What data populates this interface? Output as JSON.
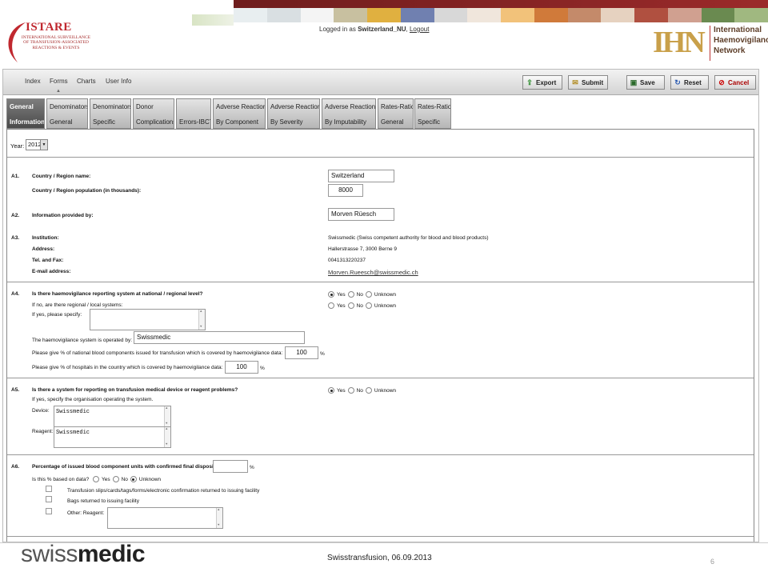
{
  "header": {
    "istare_title": "ISTARE",
    "istare_subtitle": "International Surveillance of Transfusion-Associated Reactions & Events",
    "login_prefix": "Logged in as",
    "login_user": "Switzerland_NU",
    "logout_label": "Logout",
    "ihn_letters": "IHN",
    "ihn_name_line1": "International",
    "ihn_name_line2": "Haemovigilance",
    "ihn_name_line3": "Network"
  },
  "menu": {
    "items": [
      "Index",
      "Forms",
      "Charts",
      "User Info"
    ]
  },
  "toolbar": {
    "export": "Export",
    "submit": "Submit",
    "save": "Save",
    "reset": "Reset",
    "cancel": "Cancel"
  },
  "tabs": [
    {
      "line1": "General",
      "line2": "Information",
      "active": true
    },
    {
      "line1": "Denominators",
      "line2": "General"
    },
    {
      "line1": "Denominators",
      "line2": "Specific"
    },
    {
      "line1": "Donor",
      "line2": "Complications"
    },
    {
      "line1": "",
      "line2": "Errors-IBCT"
    },
    {
      "line1": "Adverse Reactions",
      "line2": "By Component"
    },
    {
      "line1": "Adverse Reactions",
      "line2": "By Severity"
    },
    {
      "line1": "Adverse Reactions",
      "line2": "By Imputability"
    },
    {
      "line1": "Rates-Ratio",
      "line2": "General"
    },
    {
      "line1": "Rates-Ratio",
      "line2": "Specific"
    }
  ],
  "form": {
    "year_label": "Year:",
    "year_value": "2012",
    "a1": {
      "id": "A1.",
      "country_label": "Country / Region name:",
      "country_value": "Switzerland",
      "population_label": "Country / Region population (in thousands):",
      "population_value": "8000"
    },
    "a2": {
      "id": "A2.",
      "label": "Information provided by:",
      "value": "Morven Rüesch"
    },
    "a3": {
      "id": "A3.",
      "institution_label": "Institution:",
      "institution_value": "Swissmedic (Swiss competent authority for blood and blood products)",
      "address_label": "Address:",
      "address_value": "Hallerstrasse 7, 3000 Berne 9",
      "tel_label": "Tel. and Fax:",
      "tel_value": "0041313220237",
      "email_label": "E-mail address:",
      "email_value": "Morven.Rueesch@swissmedic.ch"
    },
    "a4": {
      "id": "A4.",
      "question": "Is there haemovigilance reporting system at national / regional level?",
      "regional_label": "If no, are there regional / local systems:",
      "specify_label": "If yes, please specify:",
      "operated_label": "The haemovigilance system is operated by:",
      "operated_value": "Swissmedic",
      "pct_blood_label": "Please give % of national blood components issued for transfusion which is covered by haemovigilance data:",
      "pct_blood_value": "100",
      "pct_hosp_label": "Please give % of hospitals in the country which is covered by haemovigilance data:",
      "pct_hosp_value": "100",
      "pct_sign": "%"
    },
    "a5": {
      "id": "A5.",
      "question": "Is there a system for reporting on transfusion medical device or reagent problems?",
      "specify_label": "If yes, specify the organisation operating the system.",
      "device_label": "Device:",
      "device_value": "Swissmedic",
      "reagent_label": "Reagent:",
      "reagent_value": "Swissmedic"
    },
    "a6": {
      "id": "A6.",
      "question": "Percentage of issued blood component units with confirmed final disposition:",
      "pct_sign": "%",
      "based_label": "Is this % based on data?",
      "option1": "Transfusion slips/cards/tags/forms/electronic confirmation returned to issuing facility",
      "option2": "Bags returned to issuing facility",
      "option3": "Other: Reagent:"
    },
    "radio": {
      "yes": "Yes",
      "no": "No",
      "unknown": "Unknown"
    }
  },
  "footer": {
    "brand_light": "swiss",
    "brand_bold": "medic",
    "caption": "Swisstransfusion, 06.09.2013",
    "page_number": "6"
  }
}
